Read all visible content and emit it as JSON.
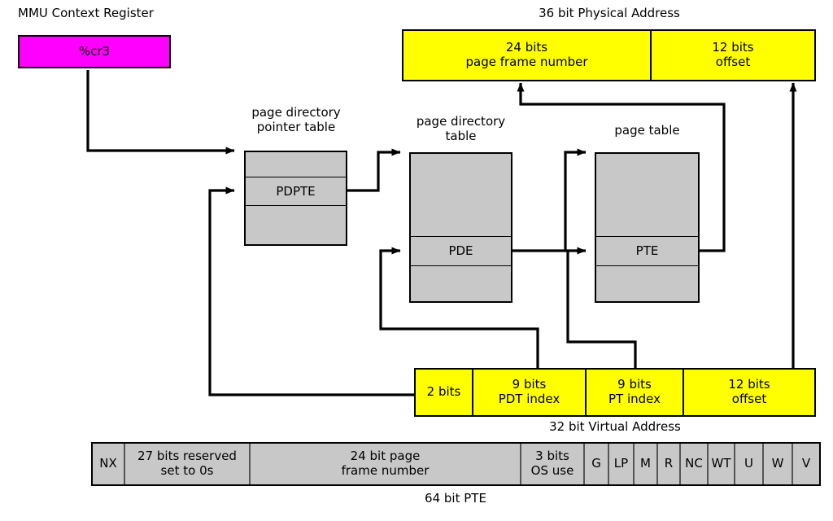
{
  "diagram": {
    "title_hidden": "x86 PAE address translation",
    "colors": {
      "register_fill": "#ff00ff",
      "address_fill": "#ffff00",
      "table_fill": "#c8c8c8",
      "line": "#000000"
    }
  },
  "mmu_register": {
    "caption": "MMU Context Register",
    "box_label": "%cr3"
  },
  "physical_address": {
    "caption": "36 bit Physical Address",
    "fields": [
      {
        "bits": "24 bits",
        "name": "page frame number"
      },
      {
        "bits": "12 bits",
        "name": "offset"
      }
    ]
  },
  "virtual_address": {
    "caption": "32 bit Virtual Address",
    "fields": [
      {
        "bits": "2 bits",
        "name": ""
      },
      {
        "bits": "9 bits",
        "name": "PDT index"
      },
      {
        "bits": "9 bits",
        "name": "PT index"
      },
      {
        "bits": "12 bits",
        "name": "offset"
      }
    ]
  },
  "tables": [
    {
      "caption": "page directory\npointer table",
      "entry_label": "PDPTE",
      "rows": [
        "",
        "PDPTE",
        ""
      ]
    },
    {
      "caption": "page directory\ntable",
      "entry_label": "PDE",
      "rows": [
        "",
        "PDE",
        ""
      ]
    },
    {
      "caption": "page table",
      "entry_label": "PTE",
      "rows": [
        "",
        "PTE",
        ""
      ]
    }
  ],
  "pte_layout": {
    "caption": "64 bit PTE",
    "fields": [
      {
        "label": "NX"
      },
      {
        "label": "27 bits reserved\nset to 0s"
      },
      {
        "label": ""
      },
      {
        "label": "24 bit page\nframe number"
      },
      {
        "label": "3 bits\nOS use"
      },
      {
        "label": "G"
      },
      {
        "label": "LP"
      },
      {
        "label": "M"
      },
      {
        "label": "R"
      },
      {
        "label": "NC"
      },
      {
        "label": "WT"
      },
      {
        "label": "U"
      },
      {
        "label": "W"
      },
      {
        "label": "V"
      }
    ]
  }
}
